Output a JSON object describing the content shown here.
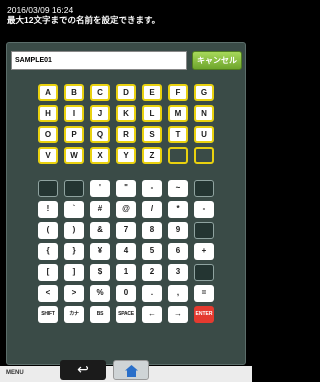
{
  "header": {
    "datetime": "2016/03/09 16:24",
    "instruction": "最大12文字までの名前を設定できます。"
  },
  "name_input": {
    "value": "SAMPLE01"
  },
  "cancel_button": {
    "label": "キャンセル"
  },
  "keyboard": {
    "letters": [
      "A",
      "B",
      "C",
      "D",
      "E",
      "F",
      "G",
      "H",
      "I",
      "J",
      "K",
      "L",
      "M",
      "N",
      "O",
      "P",
      "Q",
      "R",
      "S",
      "T",
      "U",
      "V",
      "W",
      "X",
      "Y",
      "Z"
    ],
    "symbol_rows": [
      [
        "",
        "",
        "'",
        "\"",
        "-",
        "~"
      ],
      [
        "!",
        "`",
        "#",
        "@",
        "/",
        "*",
        "-"
      ],
      [
        "(",
        ")",
        "&",
        "7",
        "8",
        "9",
        ""
      ],
      [
        "{",
        "}",
        "¥",
        "4",
        "5",
        "6",
        "+"
      ],
      [
        "[",
        "]",
        "$",
        "1",
        "2",
        "3",
        ""
      ],
      [
        "<",
        ">",
        "%",
        "0",
        ".",
        ",",
        "="
      ]
    ],
    "function_keys": [
      "SHIFT",
      "カナ",
      "BS",
      "SPACE",
      "←",
      "→",
      "ENTER"
    ]
  },
  "footer": {
    "menu_label": "MENU",
    "back_symbol": "↩"
  },
  "colors": {
    "panel": "#3a4b47",
    "key_border_letters": "#e9d10f",
    "cancel_button": "#8cc63f",
    "enter_key": "#e53a2f"
  }
}
